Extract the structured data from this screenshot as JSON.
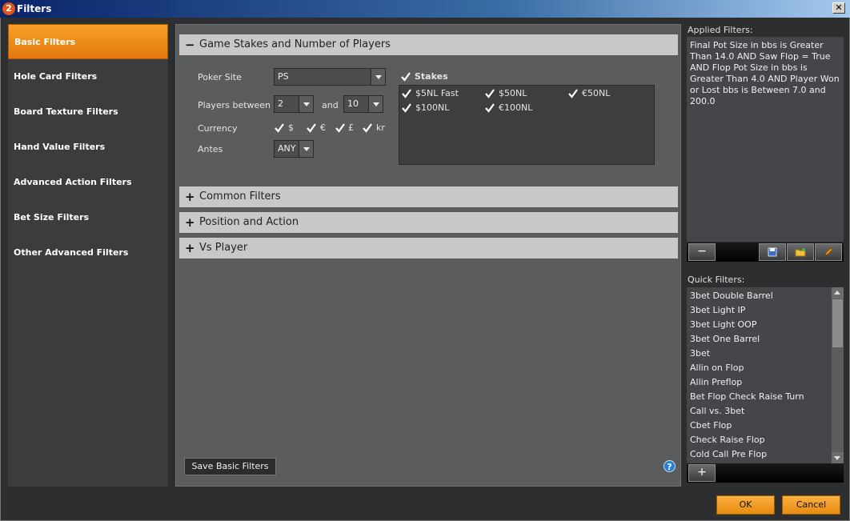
{
  "window": {
    "title": "Filters",
    "app_icon_text": "2",
    "close_glyph": "✕"
  },
  "nav": {
    "items": [
      {
        "label": "Basic Filters",
        "active": true
      },
      {
        "label": "Hole Card Filters"
      },
      {
        "label": "Board Texture Filters"
      },
      {
        "label": "Hand Value Filters"
      },
      {
        "label": "Advanced Action Filters"
      },
      {
        "label": "Bet Size Filters"
      },
      {
        "label": "Other Advanced Filters"
      }
    ]
  },
  "main": {
    "sections": [
      {
        "title": "Game Stakes and Number of Players",
        "sign": "−",
        "expanded": true
      },
      {
        "title": "Common Filters",
        "sign": "+"
      },
      {
        "title": "Position and Action",
        "sign": "+"
      },
      {
        "title": "Vs Player",
        "sign": "+"
      }
    ],
    "poker_site_label": "Poker Site",
    "poker_site_value": "PS",
    "players_between_label": "Players between",
    "players_min": "2",
    "and_label": "and",
    "players_max": "10",
    "currency_label": "Currency",
    "currencies": [
      "$",
      "€",
      "£",
      "kr"
    ],
    "antes_label": "Antes",
    "antes_value": "ANY",
    "stakes_label": "Stakes",
    "stakes": [
      "$5NL Fast",
      "$50NL",
      "€50NL",
      "$100NL",
      "€100NL"
    ],
    "save_button": "Save Basic Filters",
    "help_glyph": "?"
  },
  "right": {
    "applied_label": "Applied Filters:",
    "applied_text": "Final Pot Size in bbs is Greater Than 14.0 AND Saw Flop = True AND Flop Pot Size in bbs is Greater Than 4.0 AND Player Won or Lost bbs is Between 7.0 and 200.0",
    "applied_toolbar": {
      "remove": "−",
      "save_icon": "save-icon",
      "load_icon": "folder-icon",
      "edit_icon": "pencil-icon"
    },
    "quick_label": "Quick Filters:",
    "quick_items": [
      "3bet Double Barrel",
      "3bet Light IP",
      "3bet Light OOP",
      "3bet One Barrel",
      "3bet",
      "Allin on Flop",
      "Allin Preflop",
      "Bet Flop Check Raise Turn",
      "Call vs. 3bet",
      "Cbet Flop",
      "Check Raise Flop",
      "Cold Call Pre Flop"
    ],
    "quick_add": "+"
  },
  "buttons": {
    "ok": "OK",
    "cancel": "Cancel"
  },
  "colors": {
    "accent": "#f39a1e",
    "panel": "#5a5c5e",
    "background": "#2c2e30"
  }
}
